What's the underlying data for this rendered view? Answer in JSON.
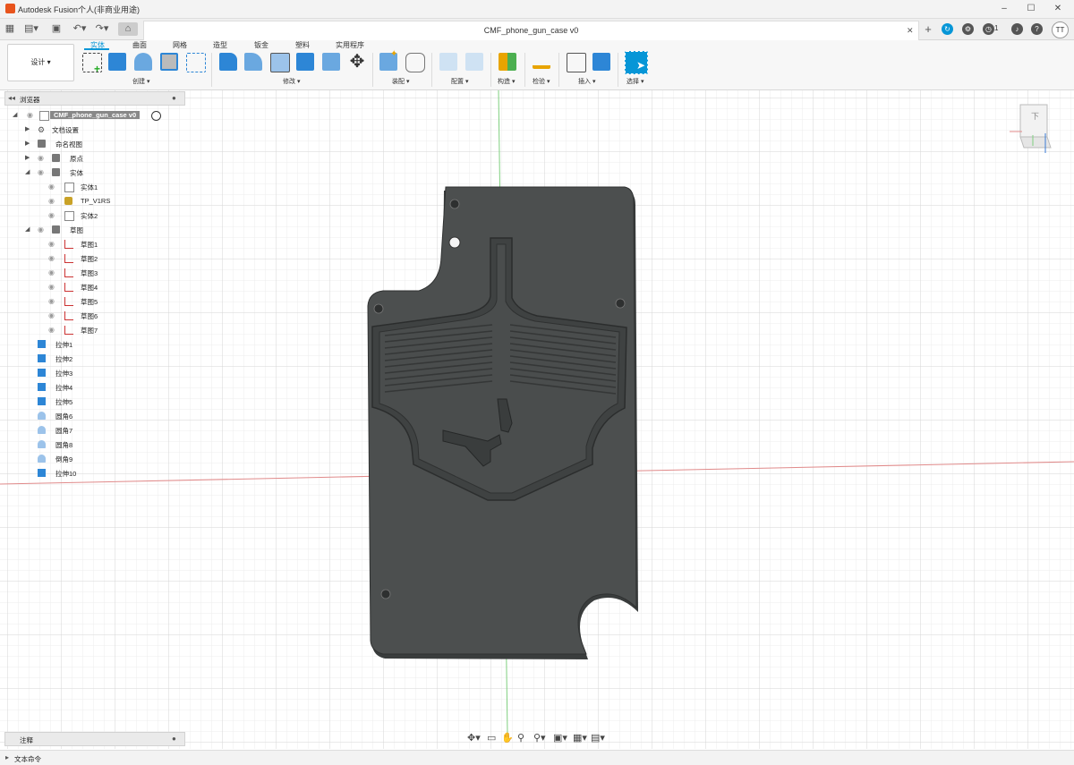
{
  "title_bar": {
    "title": "Autodesk Fusion个人(非商业用途)"
  },
  "tab_bar": {
    "doc_tab": "CMF_phone_gun_case v0",
    "notifications": "1",
    "avatar": "TT"
  },
  "ribbon": {
    "workspace": "设计 ▾",
    "tabs": [
      "实体",
      "曲面",
      "网格",
      "造型",
      "钣金",
      "塑料",
      "实用程序"
    ],
    "groups": [
      "创建 ▾",
      "修改 ▾",
      "装配 ▾",
      "配置 ▾",
      "构造 ▾",
      "检验 ▾",
      "插入 ▾",
      "选择 ▾"
    ]
  },
  "browser": {
    "header": "浏览器",
    "root": "CMF_phone_gun_case v0",
    "items": [
      "文档设置",
      "命名视图",
      "原点",
      "实体",
      "实体1",
      "TP_V1RS",
      "实体2",
      "草图",
      "草图1",
      "草图2",
      "草图3",
      "草图4",
      "草图5",
      "草图6",
      "草图7"
    ],
    "timeline": [
      "拉伸1",
      "拉伸2",
      "拉伸3",
      "拉伸4",
      "拉伸5",
      "圆角6",
      "圆角7",
      "圆角8",
      "倒角9",
      "拉伸10"
    ]
  },
  "comments": {
    "label": "注释"
  },
  "command_bar": {
    "label": "文本命令"
  },
  "viewcube": {
    "face": "下"
  },
  "colors": {
    "accent": "#0696d7",
    "model": "#4b4e4e",
    "grid": "#e3e3e3"
  }
}
